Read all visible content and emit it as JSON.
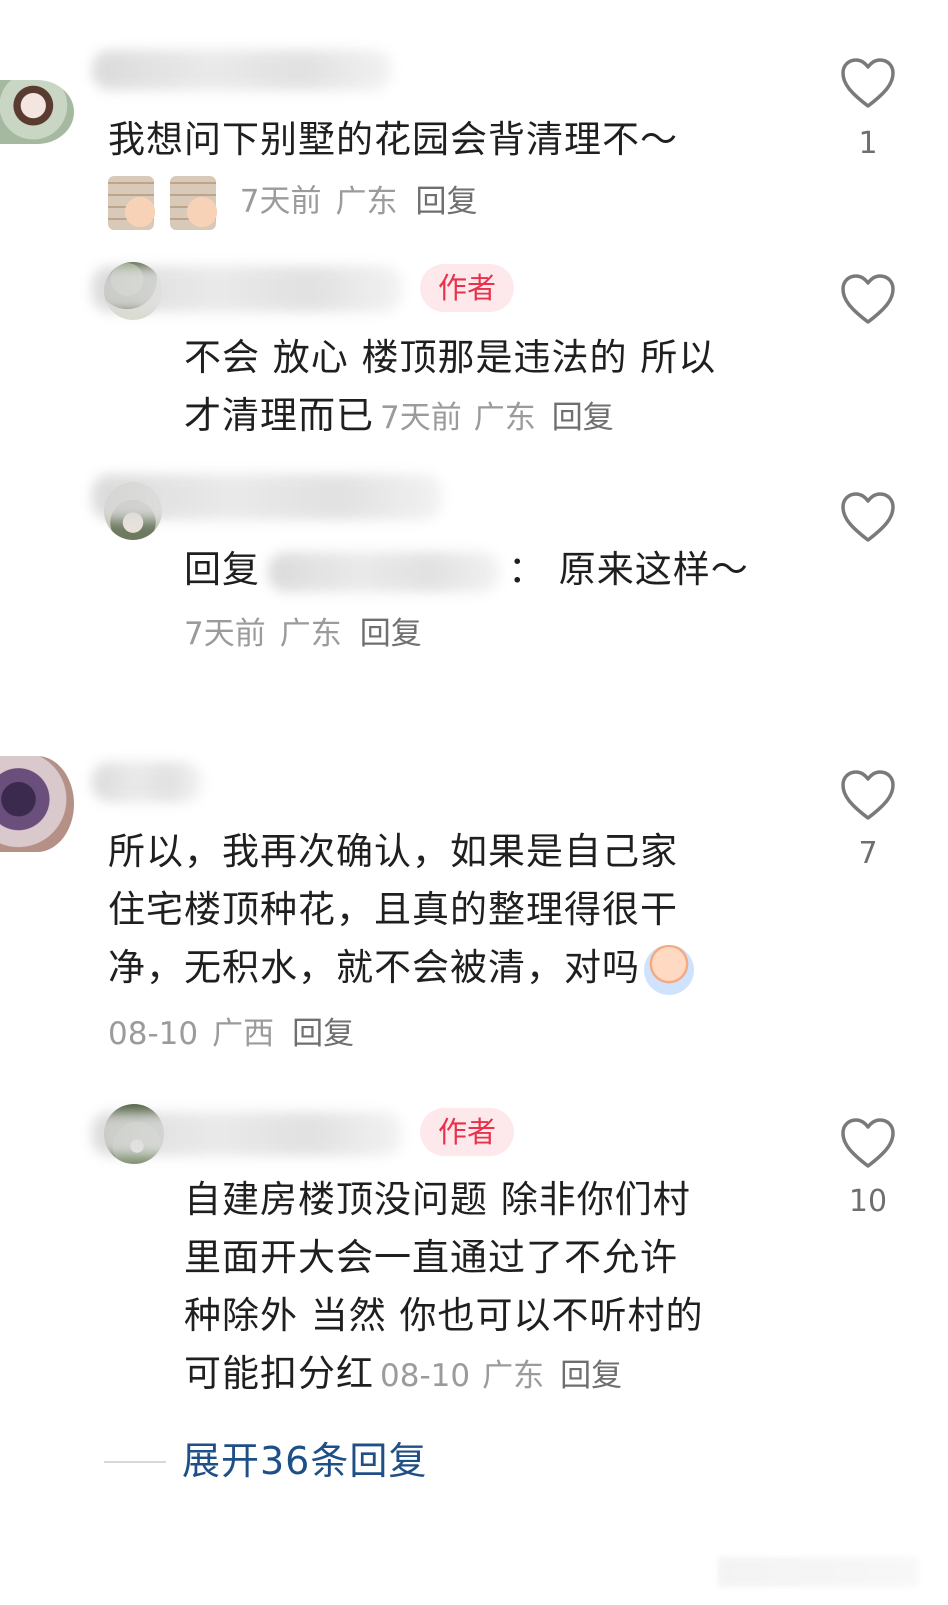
{
  "comments": [
    {
      "text_lines": [
        "我想问下别墅的花园会背清理不～"
      ],
      "time": "7天前",
      "location": "广东",
      "reply_label": "回复",
      "likes": "1",
      "stickers": [
        "sticker-sneer",
        "sticker-sneer"
      ]
    },
    {
      "author_badge": "作者",
      "text_lines": [
        "不会 放心 楼顶那是违法的 所以",
        "才清理而已"
      ],
      "time": "7天前",
      "location": "广东",
      "reply_label": "回复"
    },
    {
      "reply_prefix": "回复",
      "reply_suffix": "：  原来这样～",
      "time": "7天前",
      "location": "广东",
      "reply_label": "回复"
    },
    {
      "text_lines": [
        "所以，我再次确认，如果是自己家",
        "住宅楼顶种花，且真的整理得很干",
        "净，无积水，就不会被清，对吗"
      ],
      "time": "08-10",
      "location": "广西",
      "reply_label": "回复",
      "likes": "7",
      "sticker": "sticker-crying"
    },
    {
      "author_badge": "作者",
      "text_lines": [
        "自建房楼顶没问题 除非你们村",
        "里面开大会一直通过了不允许",
        "种除外 当然 你也可以不听村的",
        "可能扣分红"
      ],
      "time": "08-10",
      "location": "广东",
      "reply_label": "回复",
      "likes": "10"
    }
  ],
  "expand_replies": "展开36条回复",
  "colors": {
    "author_badge_bg": "#fde9ec",
    "author_badge_text": "#e8314a",
    "expand_link": "#1f4f87",
    "meta_gray": "#9b9b9b"
  },
  "icons": [
    "heart-outline-icon"
  ]
}
